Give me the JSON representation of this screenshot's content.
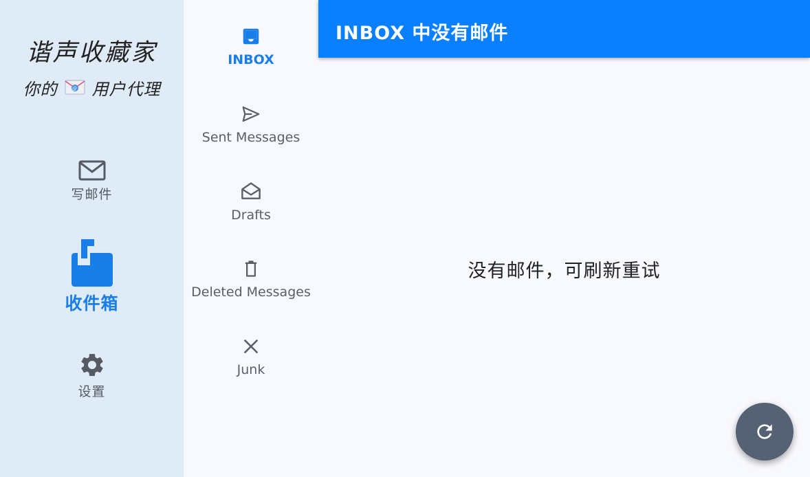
{
  "app": {
    "title": "谐声收藏家",
    "subtitle_prefix": "你的",
    "subtitle_suffix": "用户代理"
  },
  "rail": {
    "items": [
      {
        "label": "写邮件",
        "icon": "mail-icon",
        "active": false
      },
      {
        "label": "收件箱",
        "icon": "inbox-mailbox-icon",
        "active": true
      },
      {
        "label": "设置",
        "icon": "gear-icon",
        "active": false
      }
    ]
  },
  "folders": {
    "items": [
      {
        "label": "INBOX",
        "icon": "inbox-tray-icon",
        "active": true
      },
      {
        "label": "Sent Messages",
        "icon": "send-icon",
        "active": false
      },
      {
        "label": "Drafts",
        "icon": "drafts-icon",
        "active": false
      },
      {
        "label": "Deleted Messages",
        "icon": "trash-icon",
        "active": false
      },
      {
        "label": "Junk",
        "icon": "close-icon",
        "active": false
      }
    ]
  },
  "header": {
    "title": "INBOX 中没有邮件"
  },
  "main": {
    "empty_message": "没有邮件，可刷新重试"
  },
  "fab": {
    "icon": "refresh-icon"
  },
  "colors": {
    "accent": "#0a80ff",
    "rail_bg": "#e0ebf8",
    "active_text": "#1a7ee8",
    "fab_bg": "#556274"
  }
}
